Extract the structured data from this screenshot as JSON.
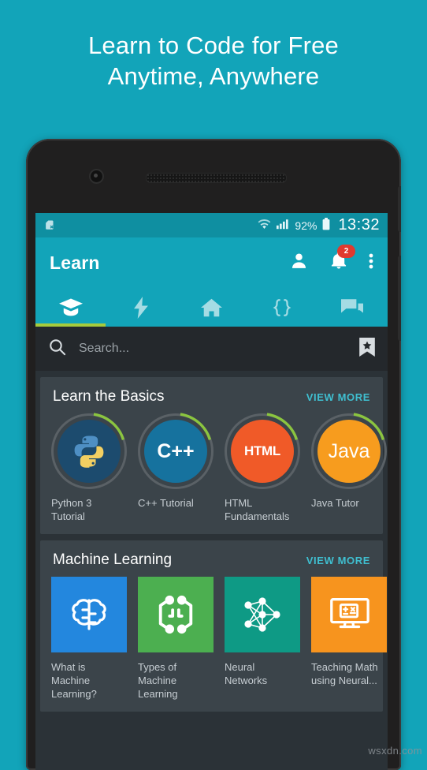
{
  "headline": {
    "line1": "Learn to Code for Free",
    "line2": "Anytime, Anywhere"
  },
  "colors": {
    "brand_teal": "#12A4B9",
    "status_teal": "#0F8FA1",
    "accent_green": "#A6CB3C",
    "card_bg": "#3B444A",
    "screen_bg": "#2B3237",
    "search_bg": "#24282C",
    "link_teal": "#3FBFD0",
    "badge_red": "#E03A2F"
  },
  "statusbar": {
    "sim_icon": "sim-card-off-icon",
    "wifi_icon": "wifi-icon",
    "signal_icon": "cellular-signal-icon",
    "battery_percent": "92%",
    "battery_icon": "battery-icon",
    "time": "13:32"
  },
  "appbar": {
    "title": "Learn",
    "account_icon": "person-icon",
    "notifications_icon": "bell-icon",
    "notifications_badge": "2",
    "overflow_icon": "more-vertical-icon"
  },
  "tabs": [
    {
      "name": "tab-learn",
      "icon": "graduation-cap-icon",
      "active": true
    },
    {
      "name": "tab-challenges",
      "icon": "lightning-bolt-icon",
      "active": false
    },
    {
      "name": "tab-home",
      "icon": "home-icon",
      "active": false
    },
    {
      "name": "tab-code",
      "icon": "curly-braces-icon",
      "active": false
    },
    {
      "name": "tab-discuss",
      "icon": "chat-bubbles-icon",
      "active": false
    }
  ],
  "search": {
    "placeholder": "Search...",
    "search_icon": "search-icon",
    "bookmark_icon": "bookmark-star-icon"
  },
  "sections": [
    {
      "title": "Learn the Basics",
      "view_more": "VIEW MORE",
      "items": [
        {
          "label": "Python 3 Tutorial",
          "icon": "python-logo-icon",
          "badge_text": "",
          "bg": "#1C4B6E",
          "progress": 18
        },
        {
          "label": "C++ Tutorial",
          "icon": "cpp-text-icon",
          "badge_text": "C++",
          "bg": "#16729E",
          "progress": 18
        },
        {
          "label": "HTML Fundamentals",
          "icon": "html-text-icon",
          "badge_text": "HTML",
          "bg": "#F05A28",
          "progress": 18
        },
        {
          "label": "Java Tutor",
          "icon": "java-text-icon",
          "badge_text": "Java",
          "bg": "#F79C1E",
          "progress": 18
        }
      ]
    },
    {
      "title": "Machine Learning",
      "view_more": "VIEW MORE",
      "items": [
        {
          "label": "What is Machine Learning?",
          "icon": "brain-circuit-icon",
          "bg": "#2387DE"
        },
        {
          "label": "Types of Machine Learning",
          "icon": "nodes-hexagon-icon",
          "bg": "#4CAF50"
        },
        {
          "label": "Neural Networks",
          "icon": "neural-network-icon",
          "bg": "#0E9A85"
        },
        {
          "label": "Teaching Math using Neural...",
          "icon": "computer-math-icon",
          "bg": "#F7941E"
        }
      ]
    }
  ],
  "watermark": "wsxdn.com"
}
